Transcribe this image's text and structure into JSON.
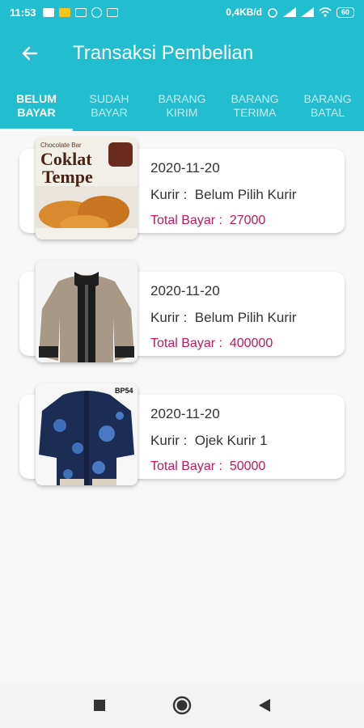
{
  "status_bar": {
    "time": "11:53",
    "network_speed": "0,4KB/d",
    "battery": "60",
    "icons_left": [
      "message-icon",
      "notification-icon",
      "gmail-icon",
      "instagram-icon",
      "laptop-icon"
    ],
    "icons_right": [
      "alarm-icon",
      "signal-icon",
      "signal-icon",
      "wifi-icon",
      "battery-icon"
    ]
  },
  "header": {
    "title": "Transaksi Pembelian",
    "back_icon": "arrow-left-icon"
  },
  "colors": {
    "primary": "#22bdcf",
    "accent_total": "#c2185b",
    "background": "#f7f7f7"
  },
  "tabs": [
    {
      "line1": "BELUM",
      "line2": "BAYAR",
      "active": true
    },
    {
      "line1": "SUDAH",
      "line2": "BAYAR",
      "active": false
    },
    {
      "line1": "BARANG",
      "line2": "KIRIM",
      "active": false
    },
    {
      "line1": "BARANG",
      "line2": "TERIMA",
      "active": false
    },
    {
      "line1": "BARANG",
      "line2": "BATAL",
      "active": false
    }
  ],
  "transactions": [
    {
      "image": "coklat-tempe-product-image",
      "image_text_top": "Chocolate Bar",
      "image_text_main1": "Coklat",
      "image_text_main2": "Tempe",
      "date": "2020-11-20",
      "kurir_label": "Kurir :",
      "kurir_value": "Belum Pilih Kurir",
      "total_label": "Total Bayar :",
      "total_value": "27000"
    },
    {
      "image": "bomber-jacket-product-image",
      "date": "2020-11-20",
      "kurir_label": "Kurir :",
      "kurir_value": "Belum Pilih Kurir",
      "total_label": "Total Bayar :",
      "total_value": "400000"
    },
    {
      "image": "batik-shirt-product-image",
      "image_text_corner": "BP54",
      "date": "2020-11-20",
      "kurir_label": "Kurir :",
      "kurir_value": "Ojek Kurir 1",
      "total_label": "Total Bayar :",
      "total_value": "50000"
    }
  ],
  "nav_bar": {
    "buttons": [
      "recents-square-icon",
      "home-circle-icon",
      "back-triangle-icon"
    ]
  }
}
